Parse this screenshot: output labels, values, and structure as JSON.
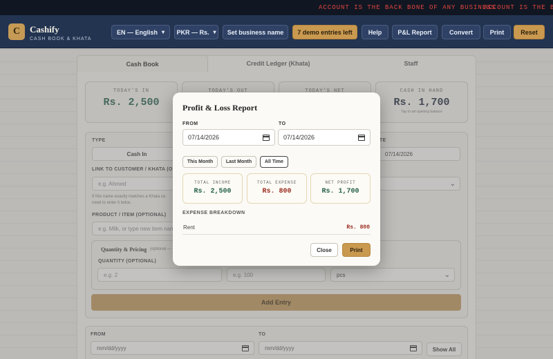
{
  "ticker": {
    "messages": [
      "ACCOUNT IS THE BACK BONE OF ANY BUSINESS",
      "ACCOUNT IS THE BACK B"
    ]
  },
  "brand": {
    "logo_letter": "C",
    "name": "Cashify",
    "tagline": "CASH BOOK & KHATA"
  },
  "header": {
    "language_select": "EN — English",
    "currency_select": "PKR — Rs.",
    "set_business_label": "Set business name",
    "demo_entries_label": "7 demo entries left",
    "help_label": "Help",
    "pl_report_label": "P&L Report",
    "convert_label": "Convert",
    "print_label": "Print",
    "reset_label": "Reset"
  },
  "tabs": [
    {
      "label": "Cash Book",
      "active": true
    },
    {
      "label": "Credit Ledger (Khata)",
      "active": false
    },
    {
      "label": "Staff",
      "active": false
    }
  ],
  "stats": {
    "in_label": "TODAY'S IN",
    "in_value": "Rs. 2,500",
    "out_label": "TODAY'S OUT",
    "net_label": "TODAY'S NET",
    "hand_label": "CASH IN HAND",
    "hand_value": "Rs. 1,700",
    "hand_hint": "Tap to set opening balance"
  },
  "form": {
    "type_label": "TYPE",
    "type_value": "Cash In",
    "date_label_fragment": "TE",
    "date_value": "07/14/2026",
    "link_label": "LINK TO CUSTOMER / KHATA (OP",
    "link_placeholder": "e.g. Ahmed",
    "link_note_1": "If this name exactly matches a Khata ca",
    "link_note_2": "need to enter it twice.",
    "product_label": "PRODUCT / ITEM (OPTIONAL)",
    "product_placeholder": "e.g. Milk, or type new item nam",
    "qty_section_title": "Quantity & Pricing",
    "qty_section_optional": "(optional —",
    "qty_label": "QUANTITY (OPTIONAL)",
    "qty_placeholder": "e.g. 2",
    "price_placeholder": "e.g. 100",
    "unit_value": "pcs",
    "add_entry_label": "Add Entry"
  },
  "filter": {
    "from_label": "FROM",
    "from_placeholder": "mm/dd/yyyy",
    "to_label": "TO",
    "to_placeholder": "mm/dd/yyyy",
    "show_all_label": "Show All"
  },
  "modal": {
    "title": "Profit & Loss Report",
    "from_label": "FROM",
    "from_value": "07/14/2026",
    "to_label": "TO",
    "to_value": "07/14/2026",
    "chips": [
      "This Month",
      "Last Month",
      "All Time"
    ],
    "active_chip": "All Time",
    "total_income_label": "TOTAL INCOME",
    "total_income_value": "Rs. 2,500",
    "total_expense_label": "TOTAL EXPENSE",
    "total_expense_value": "Rs. 800",
    "net_profit_label": "NET PROFIT",
    "net_profit_value": "Rs. 1,700",
    "breakdown_label": "EXPENSE BREAKDOWN",
    "breakdown": [
      {
        "name": "Rent",
        "amount": "Rs. 800"
      }
    ],
    "close_label": "Close",
    "print_label": "Print"
  },
  "colors": {
    "header_bg": "#233451",
    "accent_gold": "#c9994f",
    "income_green": "#23604a",
    "expense_red": "#9a2c20",
    "ticker_red": "#e0443f"
  }
}
